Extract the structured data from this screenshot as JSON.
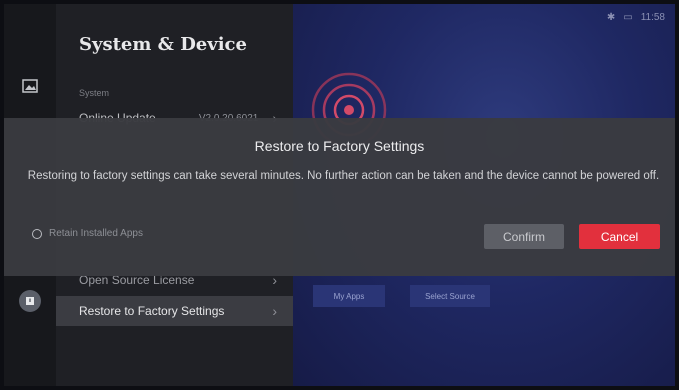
{
  "status": {
    "time": "11:58"
  },
  "panel": {
    "title": "System & Device",
    "section": "System",
    "items": [
      {
        "label": "Online Update",
        "value": "V2.0.20.6021"
      },
      {
        "label": "Open Source License"
      },
      {
        "label": "Restore to Factory Settings"
      }
    ]
  },
  "preview": {
    "tiles": [
      "My Apps",
      "Select Source"
    ]
  },
  "dialog": {
    "title": "Restore to Factory Settings",
    "message": "Restoring to factory settings can take several minutes. No further action can be taken and the device cannot be powered off.",
    "retain_label": "Retain Installed Apps",
    "confirm_label": "Confirm",
    "cancel_label": "Cancel"
  },
  "colors": {
    "cancel": "#e2303d",
    "dialog_bg": "#3a3b40",
    "preview_bg": "#1f2863"
  },
  "icons": {
    "rail": [
      "picture-icon",
      "info-icon"
    ],
    "chevron": "chevron-right-icon"
  }
}
